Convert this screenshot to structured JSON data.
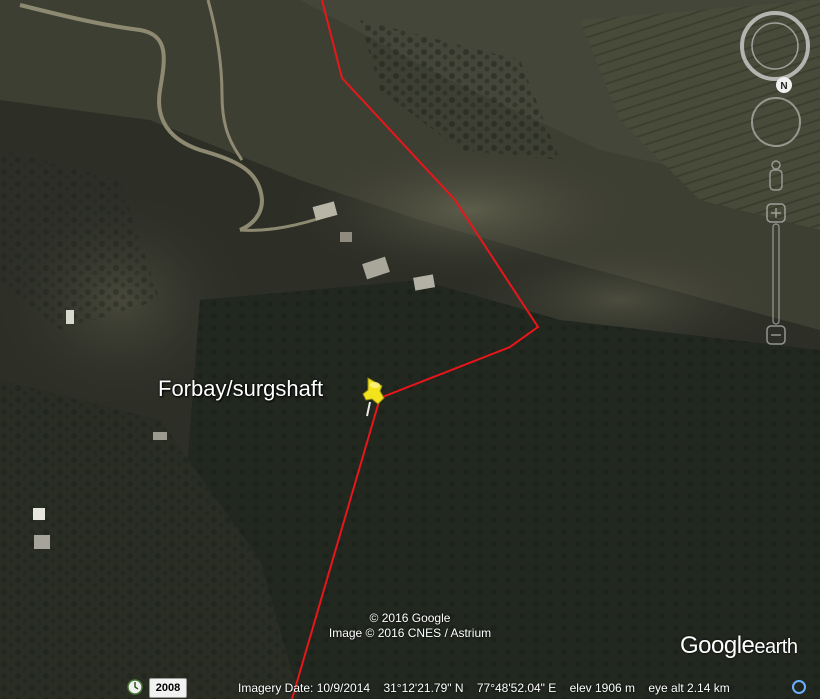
{
  "placemark": {
    "label": "Forbay/surgshaft",
    "icon": "yellow-pushpin-icon"
  },
  "attribution": {
    "line1": "© 2016 Google",
    "line2": "Image © 2016 CNES / Astrium"
  },
  "brand": {
    "google": "Google",
    "earth": "earth"
  },
  "statusbar": {
    "history_icon": "historical-imagery-icon",
    "year": "2008",
    "imagery_date": "Imagery Date: 10/9/2014",
    "latitude": "31°12'21.79\" N",
    "longitude": "77°48'52.04\" E",
    "elevation": "elev  1906 m",
    "eye_alt": "eye alt   2.14 km"
  },
  "navigation": {
    "compass_letter": "N",
    "icons": [
      "compass-ring-icon",
      "look-joystick-icon",
      "pegman-icon",
      "zoom-slider-icon"
    ]
  },
  "colors": {
    "route": "#e8161a",
    "pushpin": "#f2e31c",
    "label": "#ffffff"
  }
}
